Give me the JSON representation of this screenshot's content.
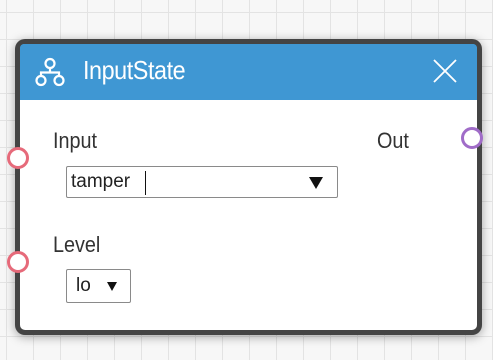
{
  "node": {
    "title": "InputState",
    "title_icon": "sitemap-icon",
    "close_icon": "close-icon",
    "header_color": "#3f97d3"
  },
  "inputs": [
    {
      "label": "Input",
      "value": "tamper",
      "port_color": "#e66a7a"
    },
    {
      "label": "Level",
      "value": "lo",
      "port_color": "#e66a7a"
    }
  ],
  "outputs": [
    {
      "label": "Out",
      "port_color": "#a06cc8"
    }
  ]
}
